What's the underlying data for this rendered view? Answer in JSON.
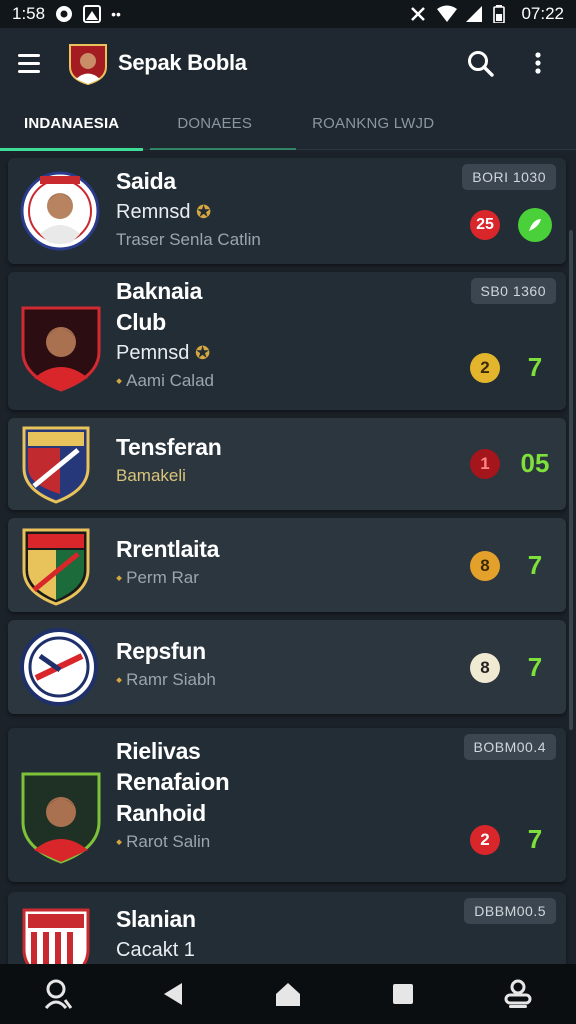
{
  "status": {
    "time_left": "1:58",
    "time_right": "07:22"
  },
  "app": {
    "title": "Sepak Bobla"
  },
  "tabs": [
    {
      "label": "INDANAESIA"
    },
    {
      "label": "DONAEES"
    },
    {
      "label": "ROANKNG LWJD"
    }
  ],
  "cards": [
    {
      "name": [
        "Saida"
      ],
      "sub": "Remnsd",
      "meta": "Traser Senla Catlin",
      "id": "BORI 1030",
      "dot": "25",
      "dot_color": "#d8262b",
      "dot_text": "#ffffff",
      "pts": "",
      "pts_circle": true
    },
    {
      "name": [
        "Baknaia",
        "Club"
      ],
      "sub": "Pemnsd",
      "meta": "Aami Calad",
      "id": "SB0 1360",
      "dot": "2",
      "dot_color": "#e3b52c",
      "dot_text": "#3a2a00",
      "pts": "7"
    },
    {
      "name": [
        "Tensferan"
      ],
      "sub": "",
      "meta": "Bamakeli",
      "id": "",
      "dot": "1",
      "dot_color": "#a4151c",
      "dot_text": "#ff8585",
      "pts": "05"
    },
    {
      "name": [
        "Rrentlaita"
      ],
      "sub": "",
      "meta": "Perm Rar",
      "id": "",
      "dot": "8",
      "dot_color": "#e3a12c",
      "dot_text": "#3a2a00",
      "pts": "7"
    },
    {
      "name": [
        "Repsfun"
      ],
      "sub": "",
      "meta": "Ramr Siabh",
      "id": "",
      "dot": "8",
      "dot_color": "#f1ead2",
      "dot_text": "#222222",
      "pts": "7"
    },
    {
      "name": [
        "Rielivas",
        "Renafaion",
        "Ranhoid"
      ],
      "sub": "",
      "meta": "Rarot Salin",
      "id": "BOBM00.4",
      "dot": "2",
      "dot_color": "#d8262b",
      "dot_text": "#ffffff",
      "pts": "7"
    },
    {
      "name": [
        "Slanian"
      ],
      "sub": "Cacakt 1",
      "meta": "",
      "id": "DBBM00.5",
      "dot": "",
      "dot_color": "",
      "dot_text": "",
      "pts": ""
    }
  ],
  "colors": {
    "accent": "#3ddc97",
    "points": "#7ee03a",
    "card": "#232d36",
    "card_alt": "#2b363f"
  },
  "icons": [
    "menu-icon",
    "search-icon",
    "overflow-menu-icon",
    "nav-user-icon",
    "nav-back-icon",
    "nav-home-icon",
    "nav-recents-icon",
    "nav-assistant-icon"
  ]
}
